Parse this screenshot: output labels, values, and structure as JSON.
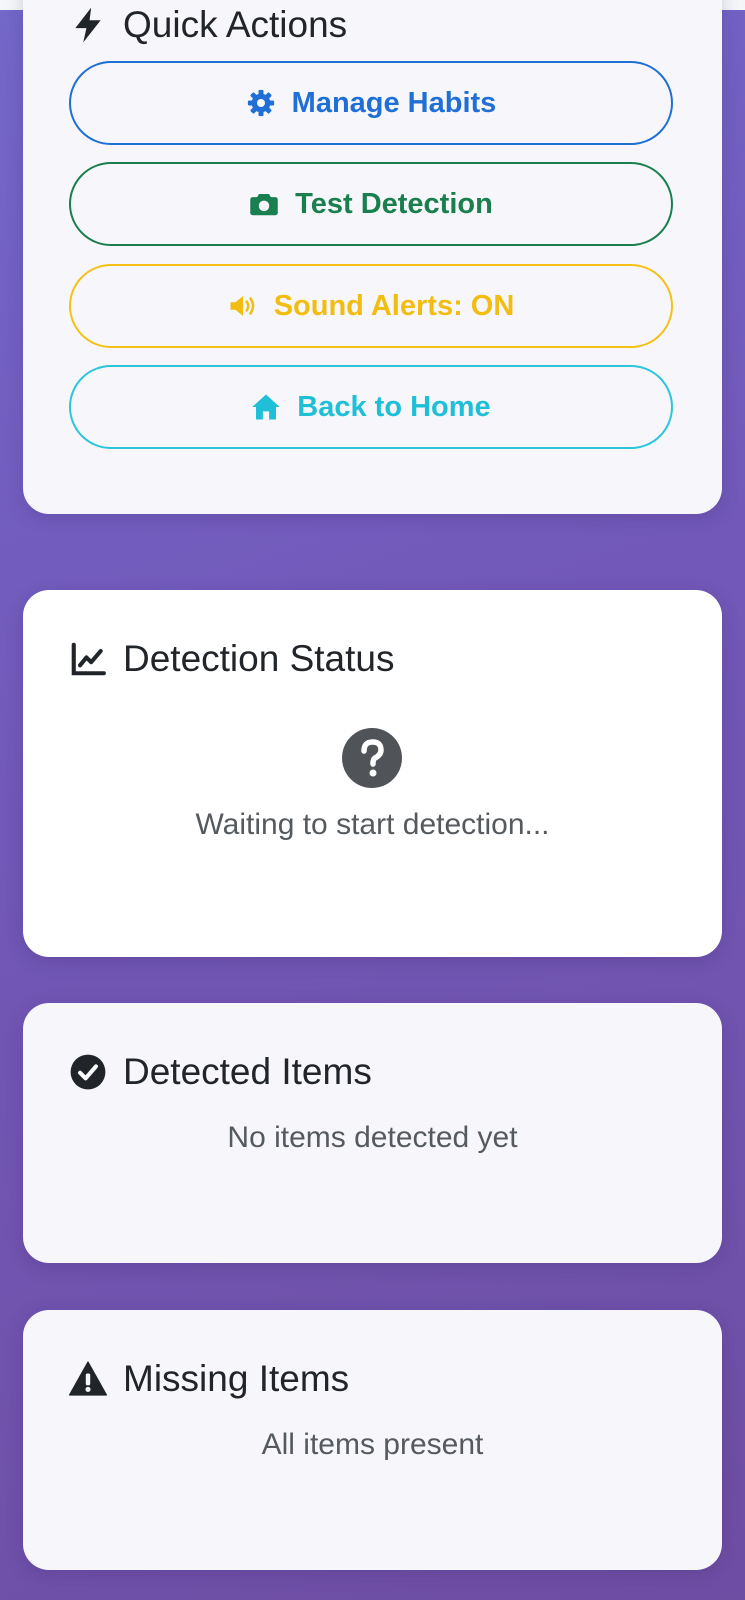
{
  "quick_actions": {
    "title": "Quick Actions",
    "title_icon": "bolt-icon",
    "buttons": [
      {
        "label": "Manage Habits",
        "icon": "gear-icon",
        "color": "#1f6fd6"
      },
      {
        "label": "Test Detection",
        "icon": "camera-icon",
        "color": "#1a7f4f"
      },
      {
        "label": "Sound Alerts: ON",
        "icon": "speaker-icon",
        "color": "#f2bd10"
      },
      {
        "label": "Back to Home",
        "icon": "home-icon",
        "color": "#1fc0d7"
      }
    ]
  },
  "detection_status": {
    "title": "Detection Status",
    "title_icon": "line-chart-icon",
    "status_icon": "question-circle-icon",
    "status_text": "Waiting to start detection..."
  },
  "detected_items": {
    "title": "Detected Items",
    "title_icon": "check-circle-icon",
    "empty_text": "No items detected yet"
  },
  "missing_items": {
    "title": "Missing Items",
    "title_icon": "warning-triangle-icon",
    "empty_text": "All items present"
  },
  "colors": {
    "background_gradient_start": "#7367c9",
    "background_gradient_end": "#6e4ea3",
    "card": "#f7f7fb",
    "status_icon": "#505458"
  }
}
